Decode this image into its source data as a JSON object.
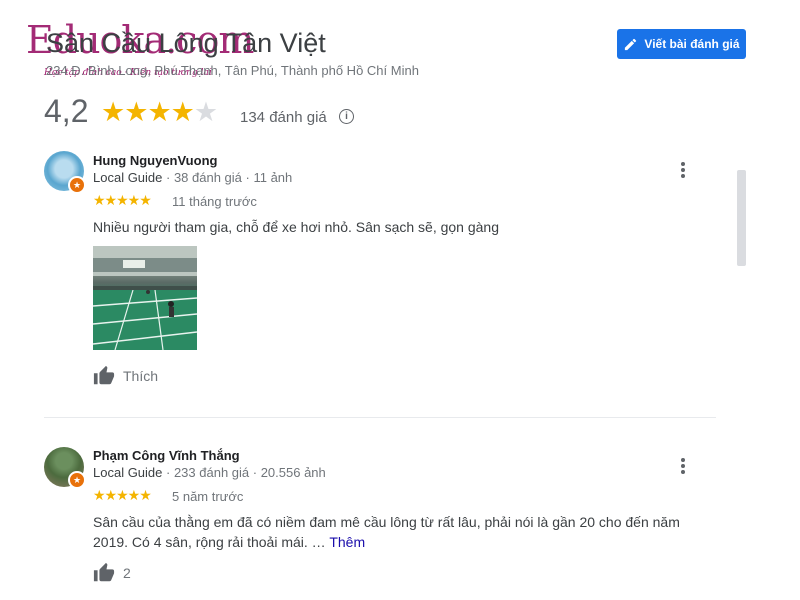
{
  "place": {
    "name": "Sân Cầu Lông Tân Việt",
    "address": "234 Đ. Bình Long, Phú Thạnh, Tân Phú, Thành phố Hồ Chí Minh",
    "rating": "4,2",
    "rating_value": 4.2,
    "stars_max": 5,
    "review_count_label": "134 đánh giá"
  },
  "write_review": {
    "label": "Viết bài đánh giá",
    "icon": "pencil-icon"
  },
  "watermark": {
    "brand": "Eduoka.com",
    "tagline": "Học tập đỉnh cao · Kiến tạo tương lai"
  },
  "colors": {
    "accent": "#1a73e8",
    "star": "#f4b400",
    "local_guide": "#e8710a",
    "link": "#1a0dab"
  },
  "reviews": [
    {
      "author": "Hung NguyenVuong",
      "badge": "Local Guide",
      "reviews_count": "38 đánh giá",
      "photos_count": "11 ảnh",
      "stars": 5,
      "time": "11 tháng trước",
      "text": "Nhiều người tham gia, chỗ để xe hơi nhỏ. Sân sạch sẽ, gọn gàng",
      "like_label": "Thích"
    },
    {
      "author": "Phạm Công Vĩnh Thắng",
      "badge": "Local Guide",
      "reviews_count": "233 đánh giá",
      "photos_count": "20.556 ảnh",
      "stars": 5,
      "time": "5 năm trước",
      "text": "Sân cầu của thằng em đã có niềm đam mê cầu lông từ rất lâu, phải nói là gần 20 cho đến năm 2019. Có 4 sân, rộng rải thoải mái.",
      "more_ellipsis": " … ",
      "more_label": "Thêm",
      "like_count": "2"
    }
  ],
  "separator": " · "
}
